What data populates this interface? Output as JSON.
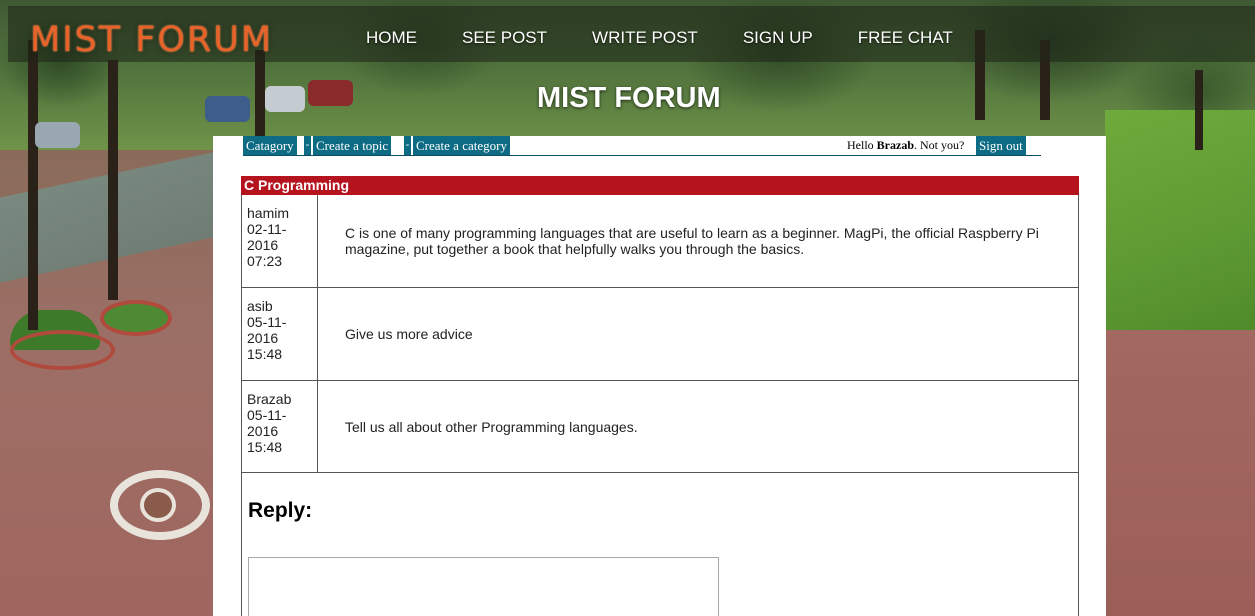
{
  "header": {
    "logo": "MIST FORUM",
    "nav": [
      "HOME",
      "SEE POST",
      "WRITE POST",
      "SIGN UP",
      "FREE CHAT"
    ],
    "site_title": "MIST FORUM"
  },
  "userbar": {
    "category_label": "Catagory",
    "sep": "-",
    "create_topic_label": "Create a topic",
    "create_category_label": "Create a category",
    "hello_prefix": "Hello",
    "username": "Brazab",
    "hello_suffix": ". Not you?",
    "sign_out_label": "Sign out"
  },
  "topic": {
    "title": "C Programming",
    "posts": [
      {
        "author": "hamim",
        "date": [
          "02-11-",
          "2016"
        ],
        "time": "07:23",
        "text": "C is one of many programming languages that are useful to learn as a beginner. MagPi, the official Raspberry Pi magazine, put together a book that helpfully walks you through the basics."
      },
      {
        "author": "asib",
        "date": [
          "05-11-",
          "2016"
        ],
        "time": "15:48",
        "text": "Give us more advice"
      },
      {
        "author": "Brazab",
        "date": [
          "05-11-",
          "2016"
        ],
        "time": "15:48",
        "text": "Tell us all about other Programming languages."
      }
    ]
  },
  "reply": {
    "title": "Reply:"
  },
  "colors": {
    "logo": "#e8622a",
    "topic_header": "#b5141f",
    "button": "#0e6b84"
  }
}
